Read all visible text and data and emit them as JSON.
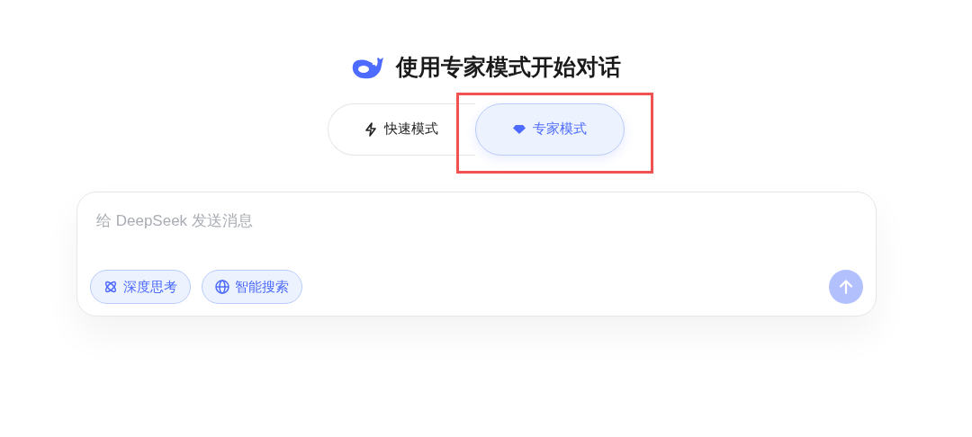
{
  "title": "使用专家模式开始对话",
  "modes": [
    {
      "label": "快速模式",
      "kind": "fast",
      "selected": false
    },
    {
      "label": "专家模式",
      "kind": "expert",
      "selected": true
    }
  ],
  "composer": {
    "placeholder": "给 DeepSeek 发送消息",
    "toggles": [
      {
        "label": "深度思考",
        "kind": "think",
        "selected": true
      },
      {
        "label": "智能搜索",
        "kind": "search",
        "selected": true
      }
    ],
    "send": {
      "disabled": true
    }
  }
}
